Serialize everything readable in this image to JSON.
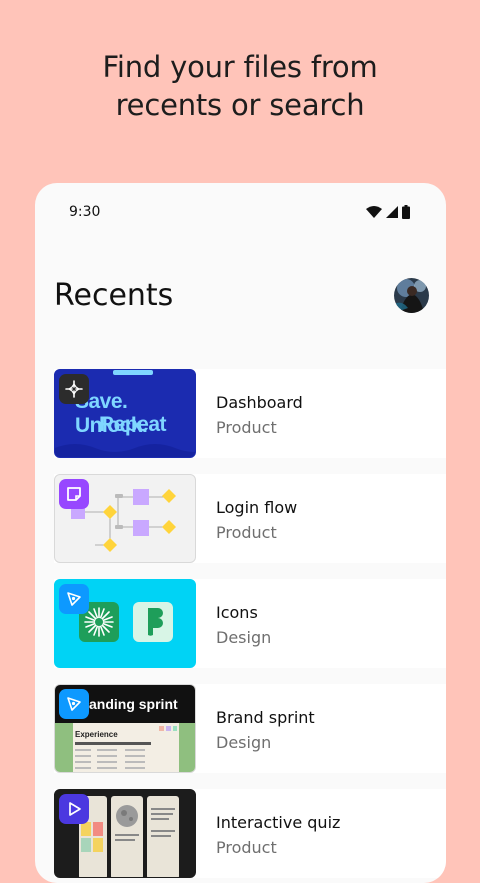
{
  "headline": {
    "line1": "Find your files from",
    "line2": "recents or search"
  },
  "status_bar": {
    "time": "9:30"
  },
  "page": {
    "title": "Recents"
  },
  "thumbnails": {
    "dashboard_text_top": "Save. Unlock.",
    "dashboard_text_bottom": "Repeat",
    "brand_sprint_banner": "anding sprint",
    "brand_sprint_heading": "Experience"
  },
  "recents": [
    {
      "name": "Dashboard",
      "team": "Product",
      "type_icon": "figjam-sparkle-icon"
    },
    {
      "name": "Login flow",
      "team": "Product",
      "type_icon": "sticky-note-icon"
    },
    {
      "name": "Icons",
      "team": "Design",
      "type_icon": "pen-tool-icon"
    },
    {
      "name": "Brand sprint",
      "team": "Design",
      "type_icon": "pen-tool-icon"
    },
    {
      "name": "Interactive quiz",
      "team": "Product",
      "type_icon": "play-icon"
    }
  ],
  "colors": {
    "background": "#FFC4B9",
    "dashboard_bg": "#1B2BB0",
    "dashboard_text": "#7FD6FF",
    "figjam_purple": "#9747FF",
    "icons_cyan": "#00D3F5",
    "design_blue": "#0D99FF",
    "prototype_blue": "#4B38E0"
  }
}
